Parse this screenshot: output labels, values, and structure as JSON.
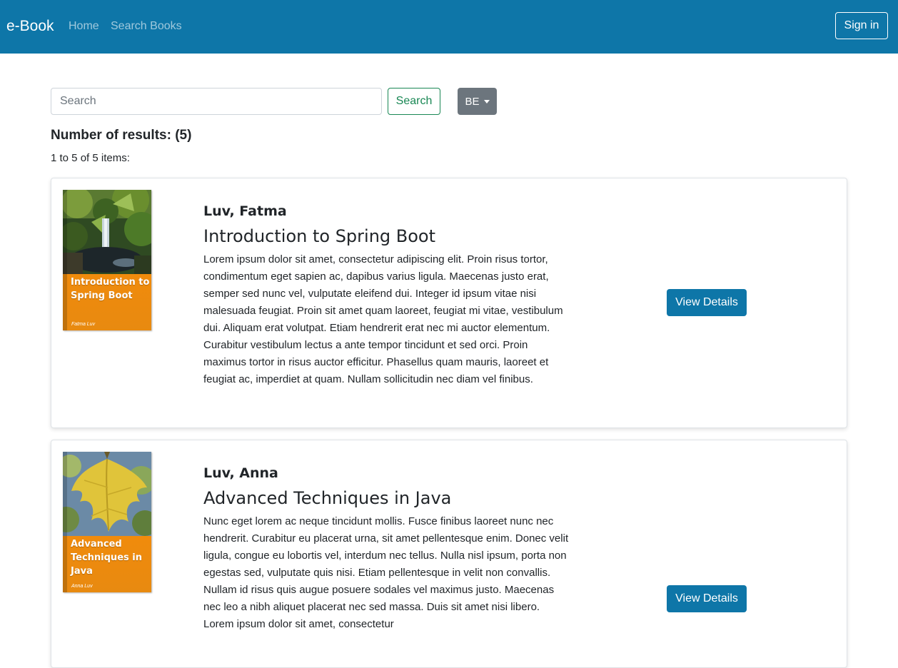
{
  "navbar": {
    "brand": "e-Book",
    "links": [
      {
        "label": "Home"
      },
      {
        "label": "Search Books"
      }
    ],
    "signin_label": "Sign in",
    "background_color": "#0e76a8"
  },
  "search": {
    "placeholder": "Search",
    "value": "",
    "button_label": "Search",
    "language_label": "BE",
    "language_icon": "caret-down-icon"
  },
  "results": {
    "count_label": "Number of results: (5)",
    "range_label": "1 to 5 of 5 items:"
  },
  "books": [
    {
      "author": "Luv, Fatma",
      "title": "Introduction to Spring Boot",
      "description": "Lorem ipsum dolor sit amet, consectetur adipiscing elit. Proin risus tortor, condimentum eget sapien ac, dapibus varius ligula. Maecenas justo erat, semper sed nunc vel, vulputate eleifend dui. Integer id ipsum vitae nisi malesuada feugiat. Proin sit amet quam laoreet, feugiat mi vitae, vestibulum dui. Aliquam erat volutpat. Etiam hendrerit erat nec mi auctor elementum. Curabitur vestibulum lectus a ante tempor tincidunt et sed orci. Proin maximus tortor in risus auctor efficitur. Phasellus quam mauris, laoreet et feugiat ac, imperdiet at quam. Nullam sollicitudin nec diam vel finibus.",
      "cover_title_lines": [
        "Introduction to",
        "Spring Boot"
      ],
      "cover_author": "Fatma Luv",
      "details_label": "View Details"
    },
    {
      "author": "Luv, Anna",
      "title": "Advanced Techniques in Java",
      "description": "Nunc eget lorem ac neque tincidunt mollis. Fusce finibus laoreet nunc nec hendrerit. Curabitur eu placerat urna, sit amet pellentesque enim. Donec velit ligula, congue eu lobortis vel, interdum nec tellus. Nulla nisl ipsum, porta non egestas sed, vulputate quis nisi. Etiam pellentesque in velit non convallis. Nullam id risus quis augue posuere sodales vel maximus justo. Maecenas nec leo a nibh aliquet placerat nec sed massa. Duis sit amet nisi libero. Lorem ipsum dolor sit amet, consectetur",
      "cover_title_lines": [
        "Advanced",
        "Techniques in",
        "Java"
      ],
      "cover_author": "Anna Luv",
      "details_label": "View Details"
    }
  ]
}
